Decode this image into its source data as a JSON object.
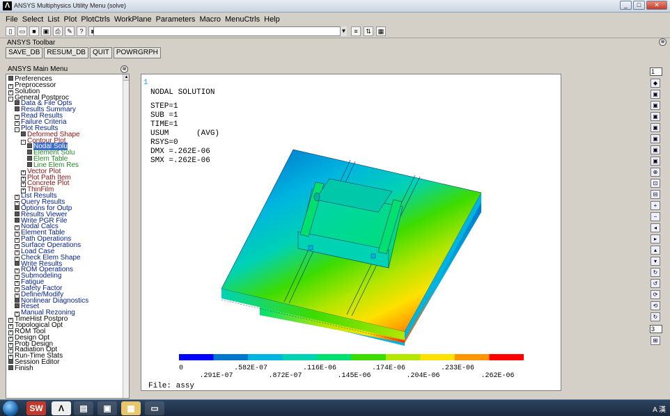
{
  "window": {
    "title": "ANSYS Multiphysics Utility Menu (solve)",
    "controls": [
      "_",
      "□",
      "✕"
    ]
  },
  "menubar": [
    "File",
    "Select",
    "List",
    "Plot",
    "PlotCtrls",
    "WorkPlane",
    "Parameters",
    "Macro",
    "MenuCtrls",
    "Help"
  ],
  "command_input": {
    "value": ""
  },
  "ansys_toolbar": {
    "heading": "ANSYS Toolbar",
    "buttons": [
      "SAVE_DB",
      "RESUM_DB",
      "QUIT",
      "POWRGRPH"
    ]
  },
  "main_menu": {
    "heading": "ANSYS Main Menu",
    "items": [
      {
        "label": "Preferences",
        "indent": 0,
        "box": "sq",
        "color": "black"
      },
      {
        "label": "Preprocessor",
        "indent": 0,
        "box": "+",
        "color": "black"
      },
      {
        "label": "Solution",
        "indent": 0,
        "box": "+",
        "color": "black"
      },
      {
        "label": "General Postproc",
        "indent": 0,
        "box": "-",
        "color": "black"
      },
      {
        "label": "Data & File Opts",
        "indent": 1,
        "box": "sq",
        "color": "blue"
      },
      {
        "label": "Results Summary",
        "indent": 1,
        "box": "sq",
        "color": "blue"
      },
      {
        "label": "Read Results",
        "indent": 1,
        "box": "+",
        "color": "blue"
      },
      {
        "label": "Failure Criteria",
        "indent": 1,
        "box": "+",
        "color": "blue"
      },
      {
        "label": "Plot Results",
        "indent": 1,
        "box": "-",
        "color": "blue"
      },
      {
        "label": "Deformed Shape",
        "indent": 2,
        "box": "sq",
        "color": "red"
      },
      {
        "label": "Contour Plot",
        "indent": 2,
        "box": "-",
        "color": "red"
      },
      {
        "label": "Nodal Solu",
        "indent": 3,
        "box": "sq",
        "color": "green",
        "selected": true
      },
      {
        "label": "Element Solu",
        "indent": 3,
        "box": "sq",
        "color": "green"
      },
      {
        "label": "Elem Table",
        "indent": 3,
        "box": "sq",
        "color": "green"
      },
      {
        "label": "Line Elem Res",
        "indent": 3,
        "box": "sq",
        "color": "green"
      },
      {
        "label": "Vector Plot",
        "indent": 2,
        "box": "+",
        "color": "red"
      },
      {
        "label": "Plot Path Item",
        "indent": 2,
        "box": "+",
        "color": "red"
      },
      {
        "label": "Concrete Plot",
        "indent": 2,
        "box": "+",
        "color": "red"
      },
      {
        "label": "ThinFilm",
        "indent": 2,
        "box": "+",
        "color": "red"
      },
      {
        "label": "List Results",
        "indent": 1,
        "box": "+",
        "color": "blue"
      },
      {
        "label": "Query Results",
        "indent": 1,
        "box": "+",
        "color": "blue"
      },
      {
        "label": "Options for Outp",
        "indent": 1,
        "box": "sq",
        "color": "blue"
      },
      {
        "label": "Results Viewer",
        "indent": 1,
        "box": "sq",
        "color": "blue"
      },
      {
        "label": "Write PGR File",
        "indent": 1,
        "box": "sq",
        "color": "blue"
      },
      {
        "label": "Nodal Calcs",
        "indent": 1,
        "box": "+",
        "color": "blue"
      },
      {
        "label": "Element Table",
        "indent": 1,
        "box": "+",
        "color": "blue"
      },
      {
        "label": "Path Operations",
        "indent": 1,
        "box": "+",
        "color": "blue"
      },
      {
        "label": "Surface Operations",
        "indent": 1,
        "box": "+",
        "color": "blue"
      },
      {
        "label": "Load Case",
        "indent": 1,
        "box": "+",
        "color": "blue"
      },
      {
        "label": "Check Elem Shape",
        "indent": 1,
        "box": "+",
        "color": "blue"
      },
      {
        "label": "Write Results",
        "indent": 1,
        "box": "sq",
        "color": "blue"
      },
      {
        "label": "ROM Operations",
        "indent": 1,
        "box": "+",
        "color": "blue"
      },
      {
        "label": "Submodeling",
        "indent": 1,
        "box": "+",
        "color": "blue"
      },
      {
        "label": "Fatigue",
        "indent": 1,
        "box": "+",
        "color": "blue"
      },
      {
        "label": "Safety Factor",
        "indent": 1,
        "box": "+",
        "color": "blue"
      },
      {
        "label": "Define/Modify",
        "indent": 1,
        "box": "+",
        "color": "blue"
      },
      {
        "label": "Nonlinear Diagnostics",
        "indent": 1,
        "box": "sq",
        "color": "blue"
      },
      {
        "label": "Reset",
        "indent": 1,
        "box": "sq",
        "color": "blue"
      },
      {
        "label": "Manual Rezoning",
        "indent": 1,
        "box": "+",
        "color": "blue"
      },
      {
        "label": "TimeHist Postpro",
        "indent": 0,
        "box": "+",
        "color": "black"
      },
      {
        "label": "Topological Opt",
        "indent": 0,
        "box": "+",
        "color": "black"
      },
      {
        "label": "ROM Tool",
        "indent": 0,
        "box": "+",
        "color": "black"
      },
      {
        "label": "Design Opt",
        "indent": 0,
        "box": "+",
        "color": "black"
      },
      {
        "label": "Prob Design",
        "indent": 0,
        "box": "+",
        "color": "black"
      },
      {
        "label": "Radiation Opt",
        "indent": 0,
        "box": "+",
        "color": "black"
      },
      {
        "label": "Run-Time Stats",
        "indent": 0,
        "box": "+",
        "color": "black"
      },
      {
        "label": "Session Editor",
        "indent": 0,
        "box": "sq",
        "color": "black"
      },
      {
        "label": "Finish",
        "indent": 0,
        "box": "sq",
        "color": "black"
      }
    ]
  },
  "graphics": {
    "window_number": "1",
    "header": "NODAL SOLUTION",
    "info_lines": [
      "STEP=1",
      "SUB =1",
      "TIME=1",
      "USUM      (AVG)",
      "RSYS=0",
      "DMX =.262E-06",
      "SMX =.262E-06"
    ],
    "legend_colors": [
      "#0000ff",
      "#0077cc",
      "#00b4e0",
      "#00d2b4",
      "#00e070",
      "#3cdc00",
      "#b4e600",
      "#ffe100",
      "#ff9600",
      "#ff0000"
    ],
    "legend_labels_top": [
      "0",
      ".582E-07",
      ".116E-06",
      ".174E-06",
      ".233E-06"
    ],
    "legend_labels_bottom": [
      ".291E-07",
      ".872E-07",
      ".145E-06",
      ".204E-06",
      ".262E-06"
    ],
    "file_label": "File: assy"
  },
  "right_toolbar": {
    "window_select_top": "1",
    "window_select_bottom": "3"
  },
  "taskbar": {
    "tray_text": "A 漢"
  }
}
